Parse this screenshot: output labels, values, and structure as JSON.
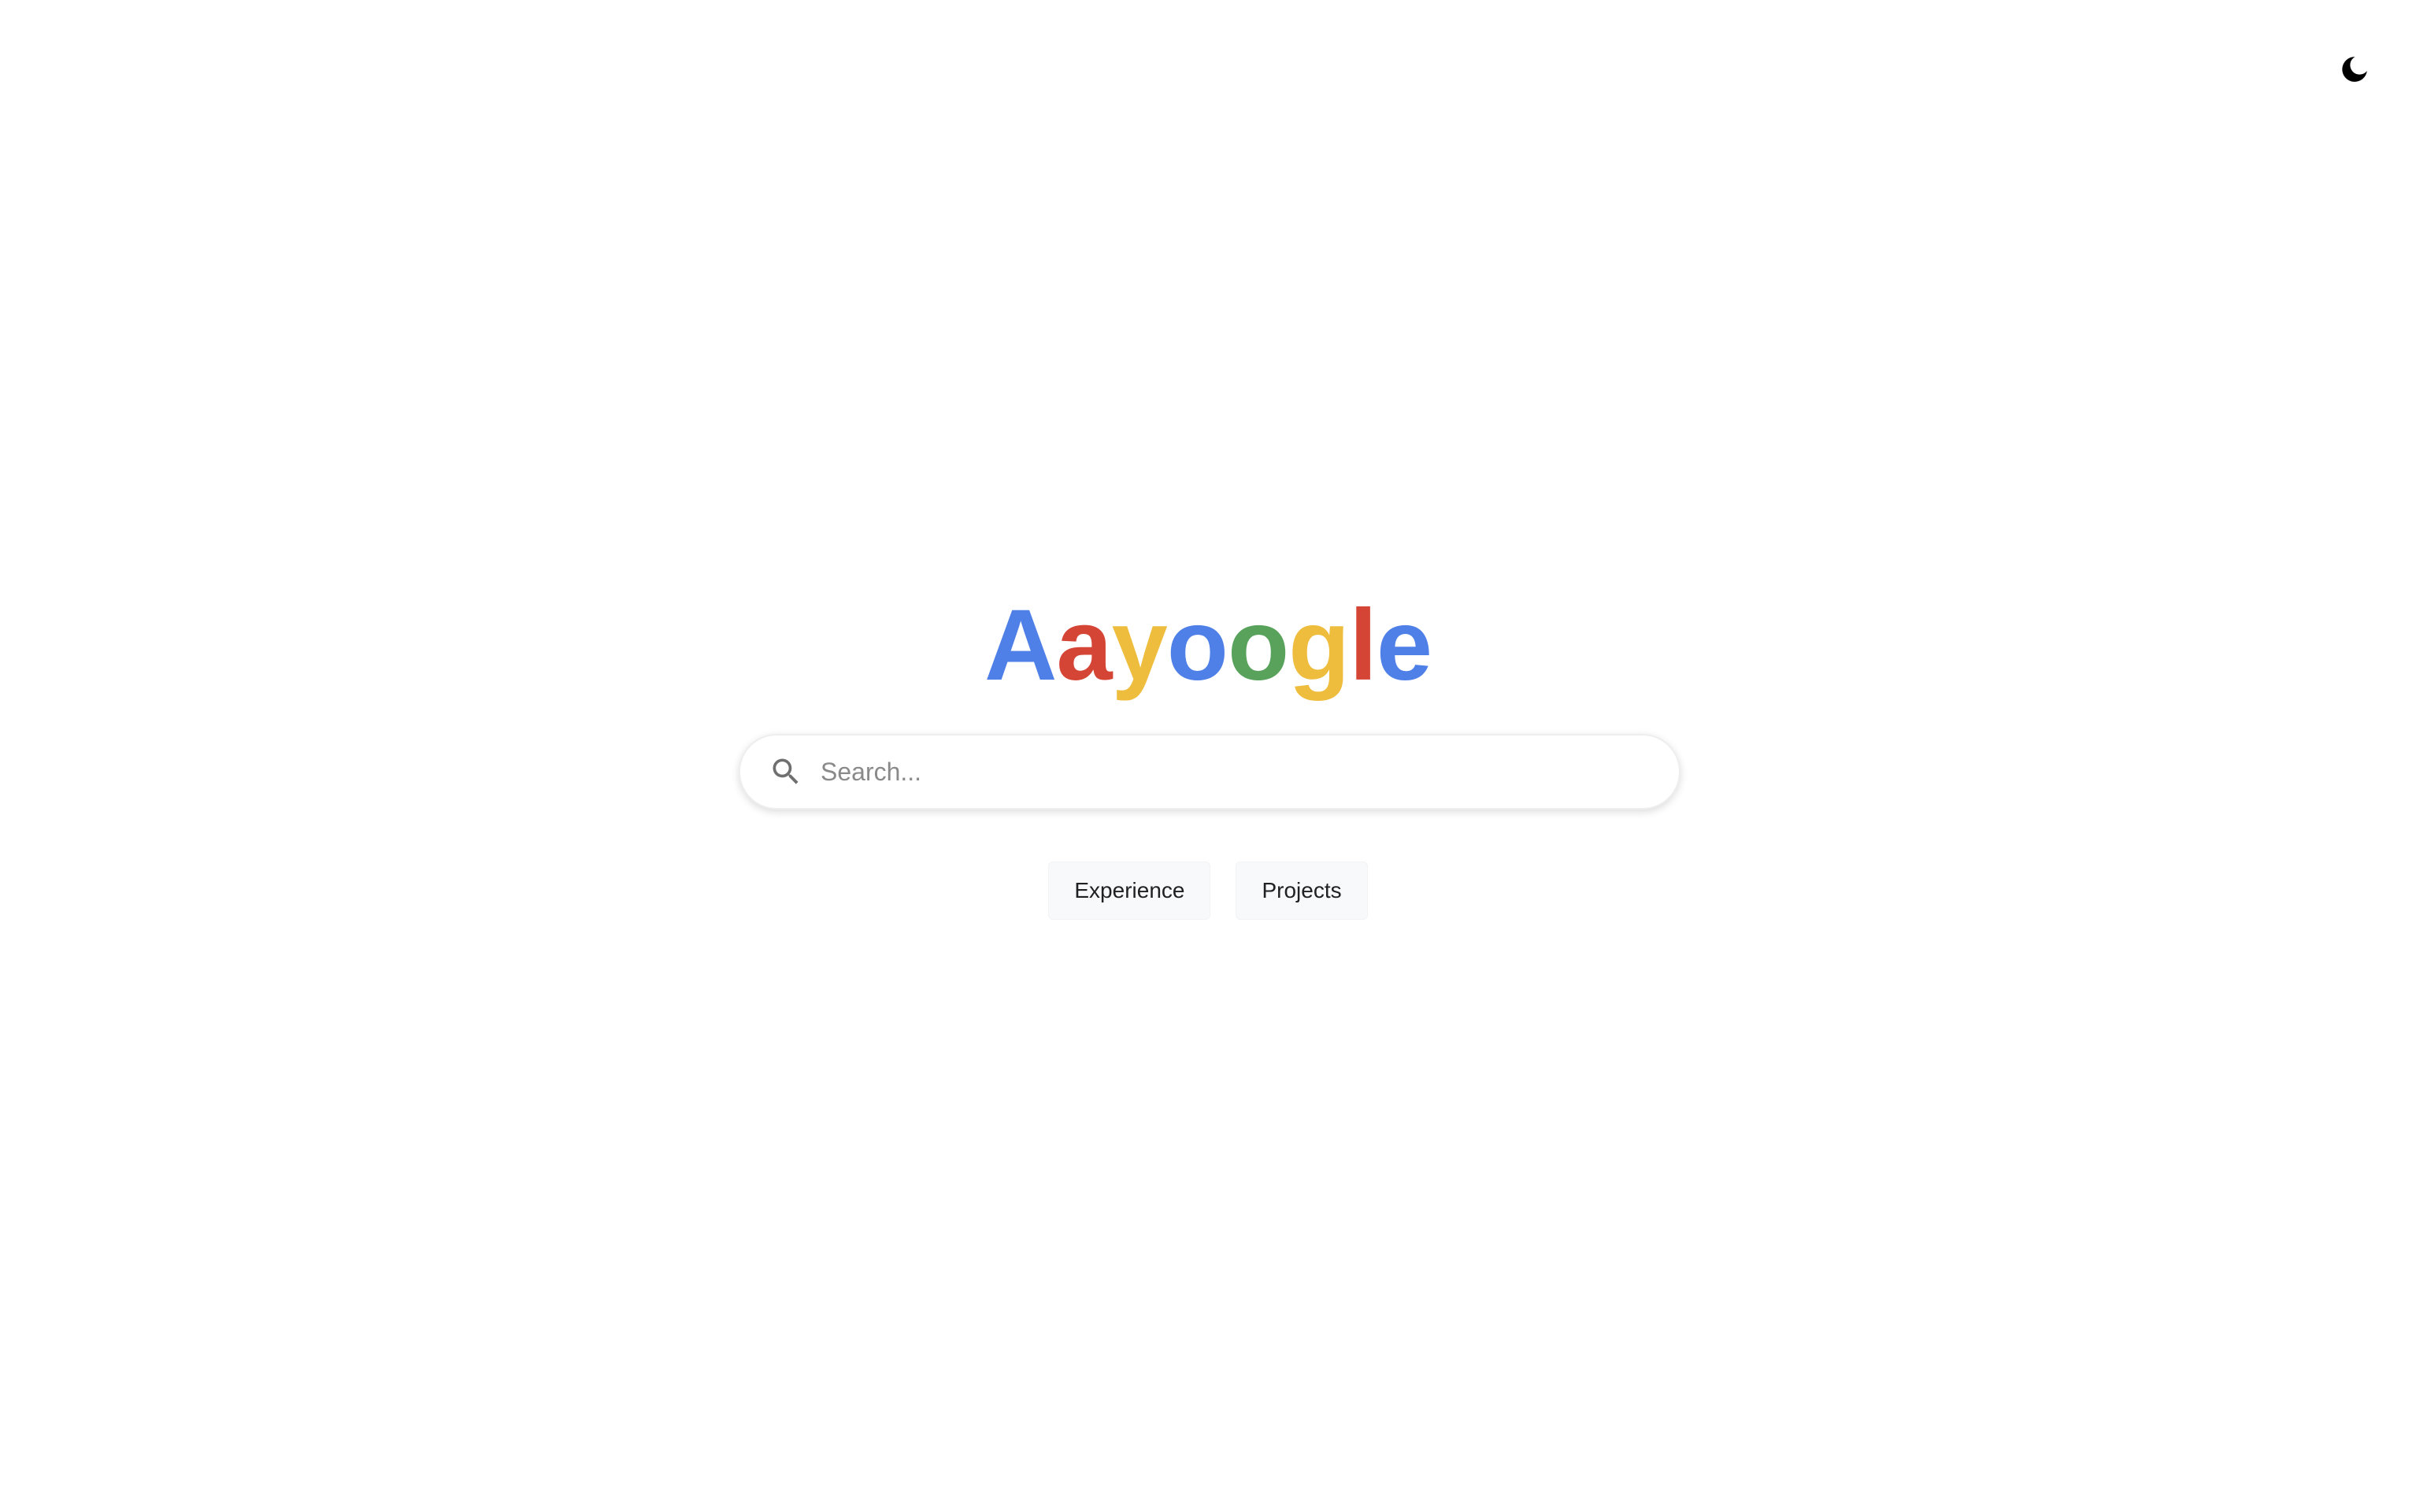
{
  "theme_toggle": {
    "icon": "moon-icon"
  },
  "logo": {
    "letters": [
      {
        "char": "A",
        "color": "#4f80e8"
      },
      {
        "char": "a",
        "color": "#d54536"
      },
      {
        "char": "y",
        "color": "#efbd3d"
      },
      {
        "char": "o",
        "color": "#4f80e8"
      },
      {
        "char": "o",
        "color": "#58a25c"
      },
      {
        "char": "g",
        "color": "#efbd3d"
      },
      {
        "char": "l",
        "color": "#d54536"
      },
      {
        "char": "e",
        "color": "#4f80e8"
      }
    ]
  },
  "search": {
    "placeholder": "Search...",
    "value": "",
    "icon": "search-icon"
  },
  "buttons": {
    "experience_label": "Experience",
    "projects_label": "Projects"
  }
}
